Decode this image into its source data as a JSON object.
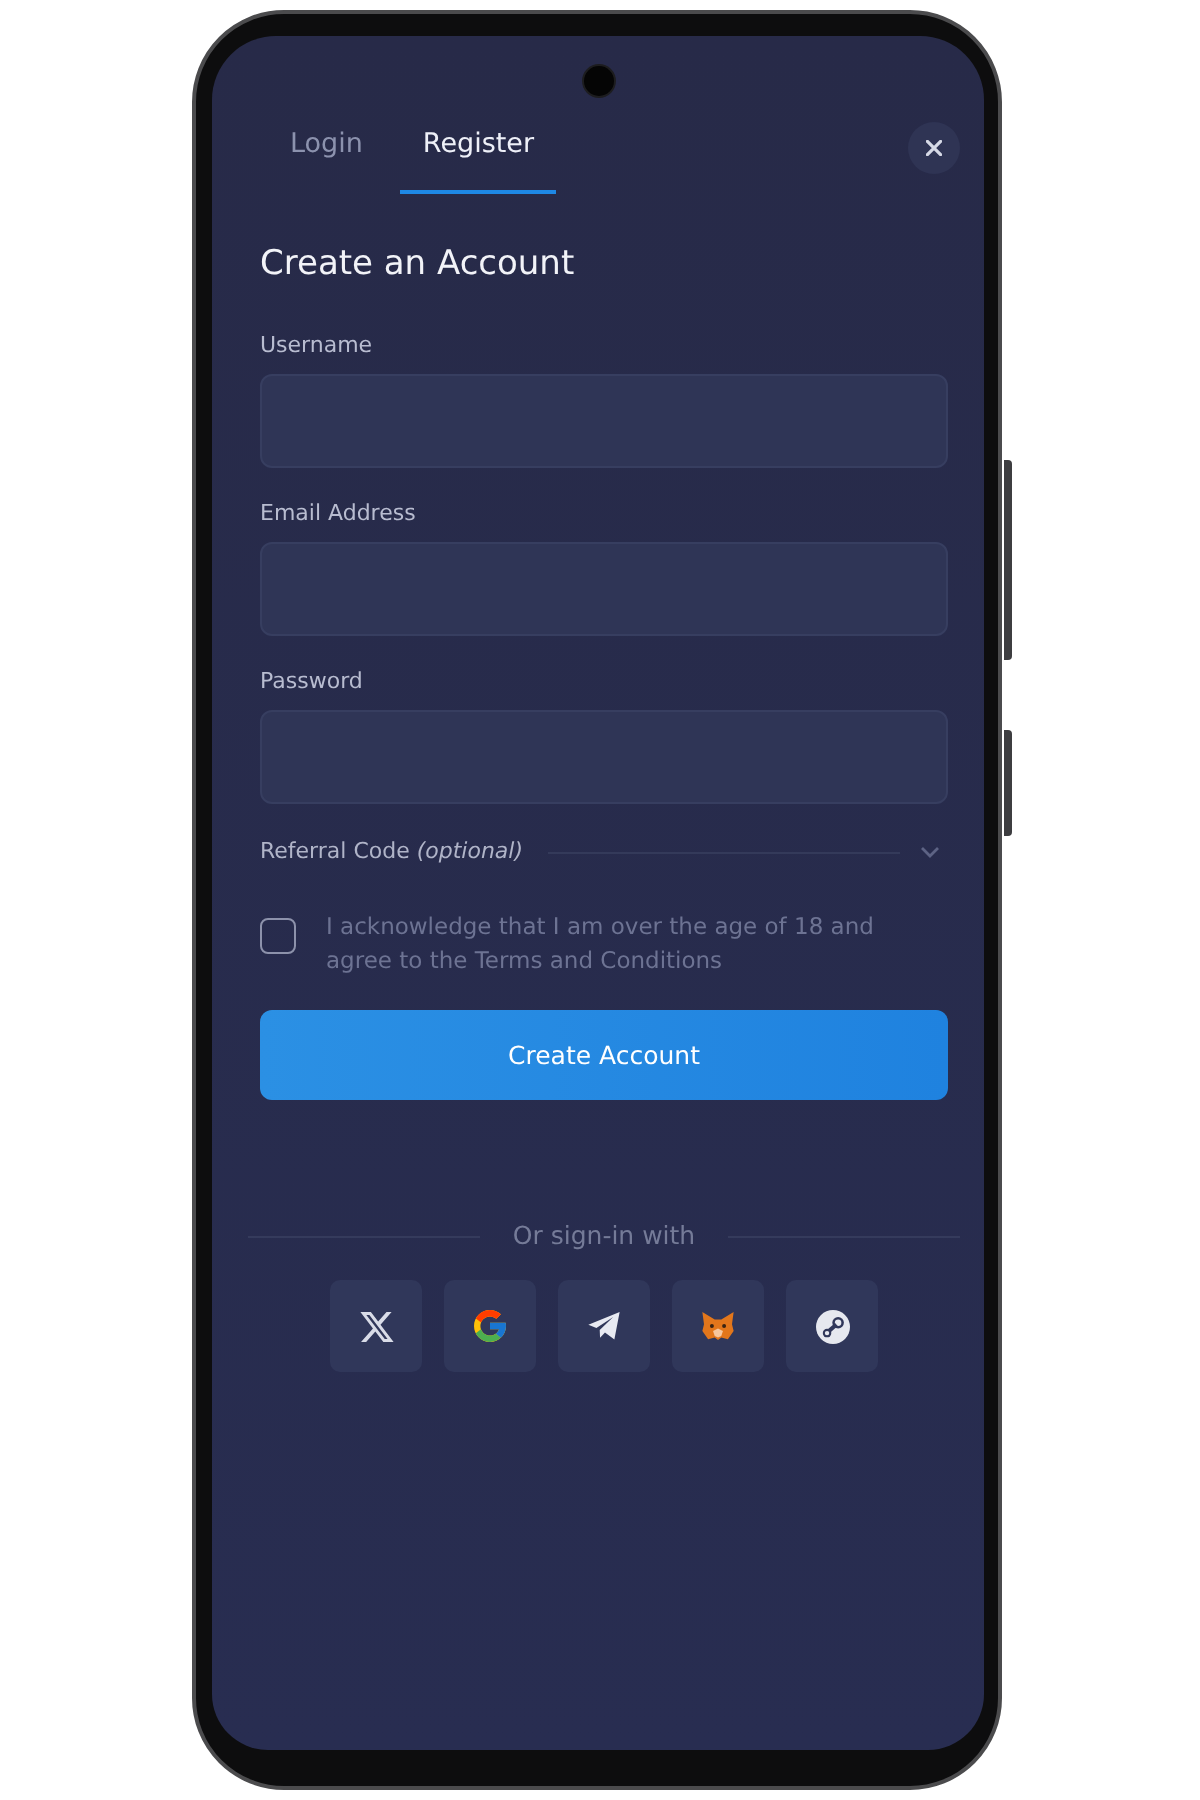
{
  "tabs": [
    {
      "label": "Login",
      "selected": false
    },
    {
      "label": "Register",
      "selected": true
    }
  ],
  "heading": "Create an Account",
  "fields": [
    {
      "label": "Username"
    },
    {
      "label": "Email Address"
    },
    {
      "label": "Password"
    }
  ],
  "referral_code": {
    "label": "Referral Code *(optional)*",
    "expanded": false
  },
  "agreement": {
    "text": "I acknowledge that I am over the age of 18 and agree to the Terms and Conditions",
    "checked": false
  },
  "submit_button": "Create Account",
  "social_sign_in": {
    "caption": "Or sign-in with",
    "providers": [
      {
        "kind": "x"
      },
      {
        "kind": "google"
      },
      {
        "kind": "telegram"
      },
      {
        "kind": "metamask"
      },
      {
        "kind": "steam"
      }
    ]
  }
}
